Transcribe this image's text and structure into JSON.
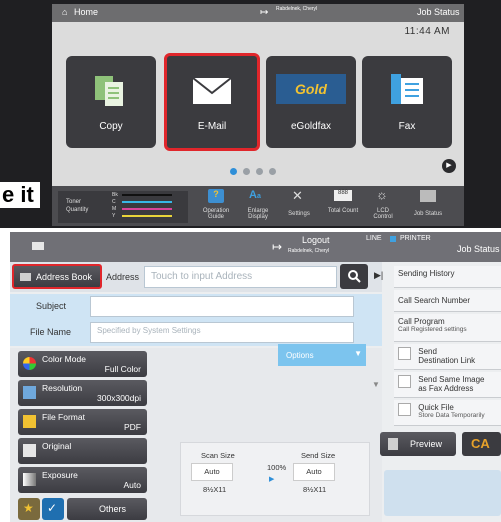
{
  "top_screen": {
    "home_label": "Home",
    "logout_user": "Rabdelnek, Cheryl",
    "job_status": "Job Status",
    "time": "11:44 AM",
    "tiles": [
      {
        "label": "Copy",
        "icon": "copy-icon"
      },
      {
        "label": "E-Mail",
        "icon": "envelope-icon"
      },
      {
        "label": "eGoldfax",
        "icon": "gold-logo"
      },
      {
        "label": "Fax",
        "icon": "fax-icon"
      }
    ],
    "gold_logo_text": "Gold",
    "page_dots": 4,
    "active_dot": 0,
    "toner": {
      "label": "Toner",
      "sublabel": "Quantity",
      "channels": [
        "Bk",
        "C",
        "M",
        "Y"
      ]
    },
    "bottom_icons": [
      {
        "label": "Operation Guide",
        "icon": "help-icon"
      },
      {
        "label": "Enlarge Display",
        "icon": "enlarge-icon"
      },
      {
        "label": "Settings",
        "icon": "wrench-icon"
      },
      {
        "label": "Total Count",
        "icon": "counter-icon"
      },
      {
        "label": "LCD Control",
        "icon": "brightness-icon"
      },
      {
        "label": "Job Status",
        "icon": "printer-icon"
      }
    ],
    "side_overlay_text": "e it"
  },
  "email_screen": {
    "header": {
      "logout_label": "Logout",
      "logout_user": "Rabdelnek, Cheryl",
      "line_label": "LINE",
      "printer_label": "PRINTER",
      "job_status": "Job Status"
    },
    "address_book_label": "Address Book",
    "address_label": "Address",
    "address_placeholder": "Touch to input Address",
    "subject_label": "Subject",
    "file_name_label": "File Name",
    "file_name_placeholder": "Specified by System Settings",
    "options_label": "Options",
    "settings": [
      {
        "label": "Color Mode",
        "value": "Full Color",
        "icon": "color-mode-icon"
      },
      {
        "label": "Resolution",
        "value": "300x300dpi",
        "icon": "resolution-icon"
      },
      {
        "label": "File Format",
        "value": "PDF",
        "icon": "file-format-icon"
      },
      {
        "label": "Original",
        "value": "",
        "icon": "original-icon"
      },
      {
        "label": "Exposure",
        "value": "Auto",
        "icon": "exposure-icon"
      }
    ],
    "others_label": "Others",
    "scan_size": {
      "label": "Scan Size",
      "mode": "Auto",
      "size": "8½X11"
    },
    "ratio": "100%",
    "send_size": {
      "label": "Send Size",
      "mode": "Auto",
      "size": "8½X11"
    },
    "side_menu": [
      {
        "label": "Sending History",
        "sub": "",
        "checkbox": false
      },
      {
        "label": "Call Search Number",
        "sub": "",
        "checkbox": false
      },
      {
        "label": "Call Program",
        "sub": "Call Registered settings",
        "checkbox": false
      },
      {
        "label": "Send",
        "sub": "Destination Link",
        "checkbox": true
      },
      {
        "label": "Send Same Image",
        "sub": "as Fax Address",
        "checkbox": true
      },
      {
        "label": "Quick File",
        "sub": "Store Data Temporarily",
        "checkbox": true
      }
    ],
    "preview_label": "Preview",
    "ca_label": "CA",
    "colors": {
      "highlight": "#e0262b",
      "accent_blue": "#7cc4ee",
      "ca_orange": "#e6a12a"
    }
  }
}
